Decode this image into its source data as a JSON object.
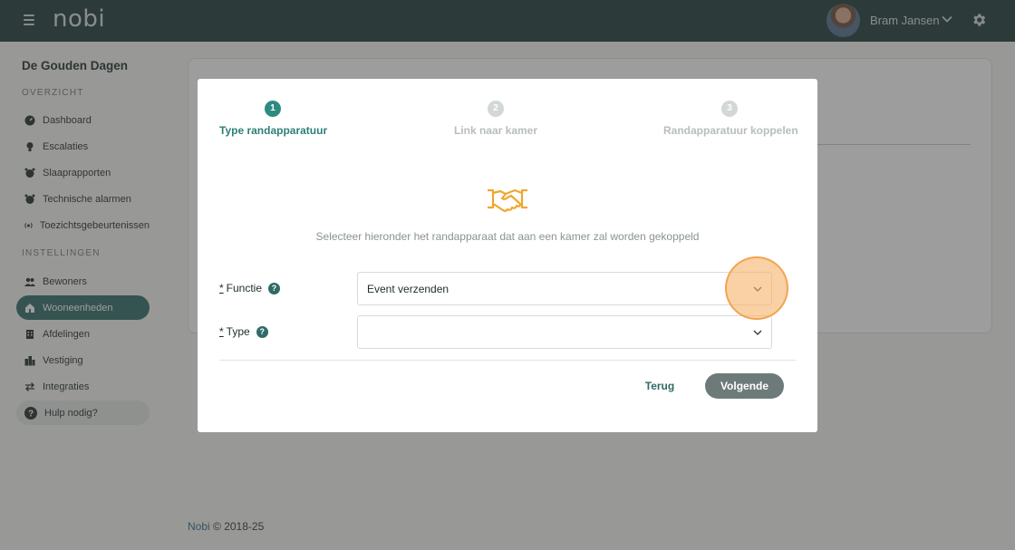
{
  "header": {
    "logo": "nobi",
    "user_name": "Bram Jansen",
    "icons": [
      "menu-icon",
      "chevron-down-icon",
      "gear-icon"
    ]
  },
  "sidebar": {
    "org_name": "De Gouden Dagen",
    "overview_label": "OVERZICHT",
    "overview_items": [
      {
        "label": "Dashboard",
        "icon": "dashboard-icon"
      },
      {
        "label": "Escalaties",
        "icon": "bulb-icon"
      },
      {
        "label": "Slaaprapporten",
        "icon": "alarm-clock-icon"
      },
      {
        "label": "Technische alarmen",
        "icon": "alarm-clock-icon"
      },
      {
        "label": "Toezichtsgebeurtenissen",
        "icon": "broadcast-icon"
      }
    ],
    "settings_label": "INSTELLINGEN",
    "settings_items": [
      {
        "label": "Bewoners",
        "icon": "users-icon"
      },
      {
        "label": "Wooneenheden",
        "icon": "home-icon",
        "active": true
      },
      {
        "label": "Afdelingen",
        "icon": "building-icon"
      },
      {
        "label": "Vestiging",
        "icon": "city-icon"
      },
      {
        "label": "Integraties",
        "icon": "swap-icon"
      }
    ],
    "help_label": "Hulp nodig?"
  },
  "footer": {
    "brand": "Nobi",
    "copyright": "© 2018-25"
  },
  "modal": {
    "steps": [
      {
        "number": "1",
        "label": "Type randapparatuur",
        "active": true
      },
      {
        "number": "2",
        "label": "Link naar kamer",
        "active": false
      },
      {
        "number": "3",
        "label": "Randapparatuur koppelen",
        "active": false
      }
    ],
    "intro": "Selecteer hieronder het randapparaat dat aan een kamer zal worden gekoppeld",
    "fields": {
      "function": {
        "required_mark": "*",
        "label": "Functie",
        "value": "Event verzenden"
      },
      "type": {
        "required_mark": "*",
        "label": "Type",
        "value": ""
      }
    },
    "back_label": "Terug",
    "next_label": "Volgende"
  },
  "colors": {
    "topbar": "#1d3a38",
    "accent": "#2e6b66",
    "step_active": "#2f8b82",
    "handshake": "#f0a631",
    "highlight": "#f7b267"
  }
}
